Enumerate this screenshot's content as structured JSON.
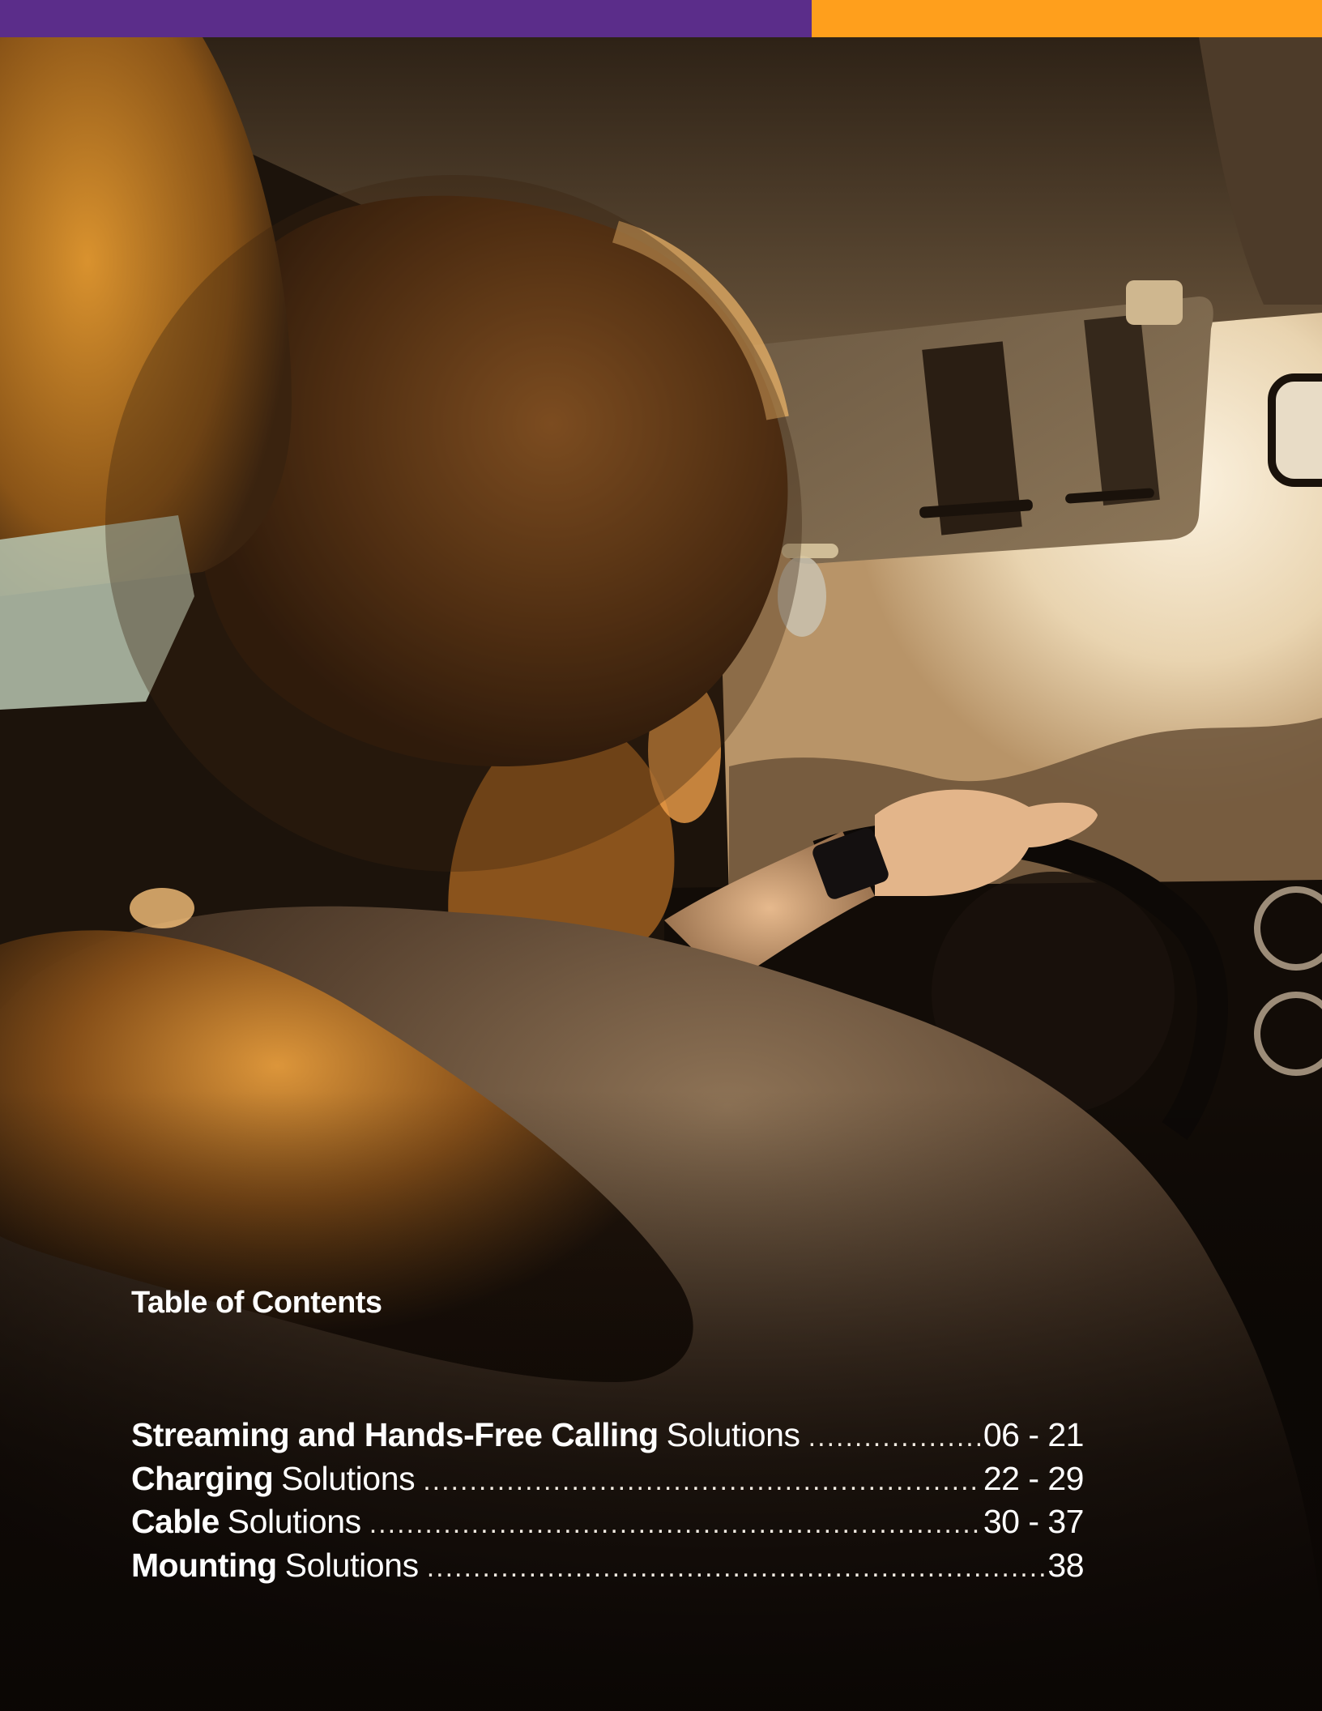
{
  "colors": {
    "bar_purple": "#5b2d8a",
    "bar_orange": "#ff9f1c",
    "text": "#ffffff"
  },
  "toc": {
    "title": "Table of Contents",
    "entries": [
      {
        "bold": "Streaming and Hands-Free Calling",
        "rest": "Solutions",
        "pages": "06 - 21"
      },
      {
        "bold": "Charging",
        "rest": "Solutions",
        "pages": "22 - 29"
      },
      {
        "bold": "Cable",
        "rest": "Solutions",
        "pages": "30 - 37"
      },
      {
        "bold": "Mounting",
        "rest": "Solutions",
        "pages": "38"
      }
    ]
  }
}
